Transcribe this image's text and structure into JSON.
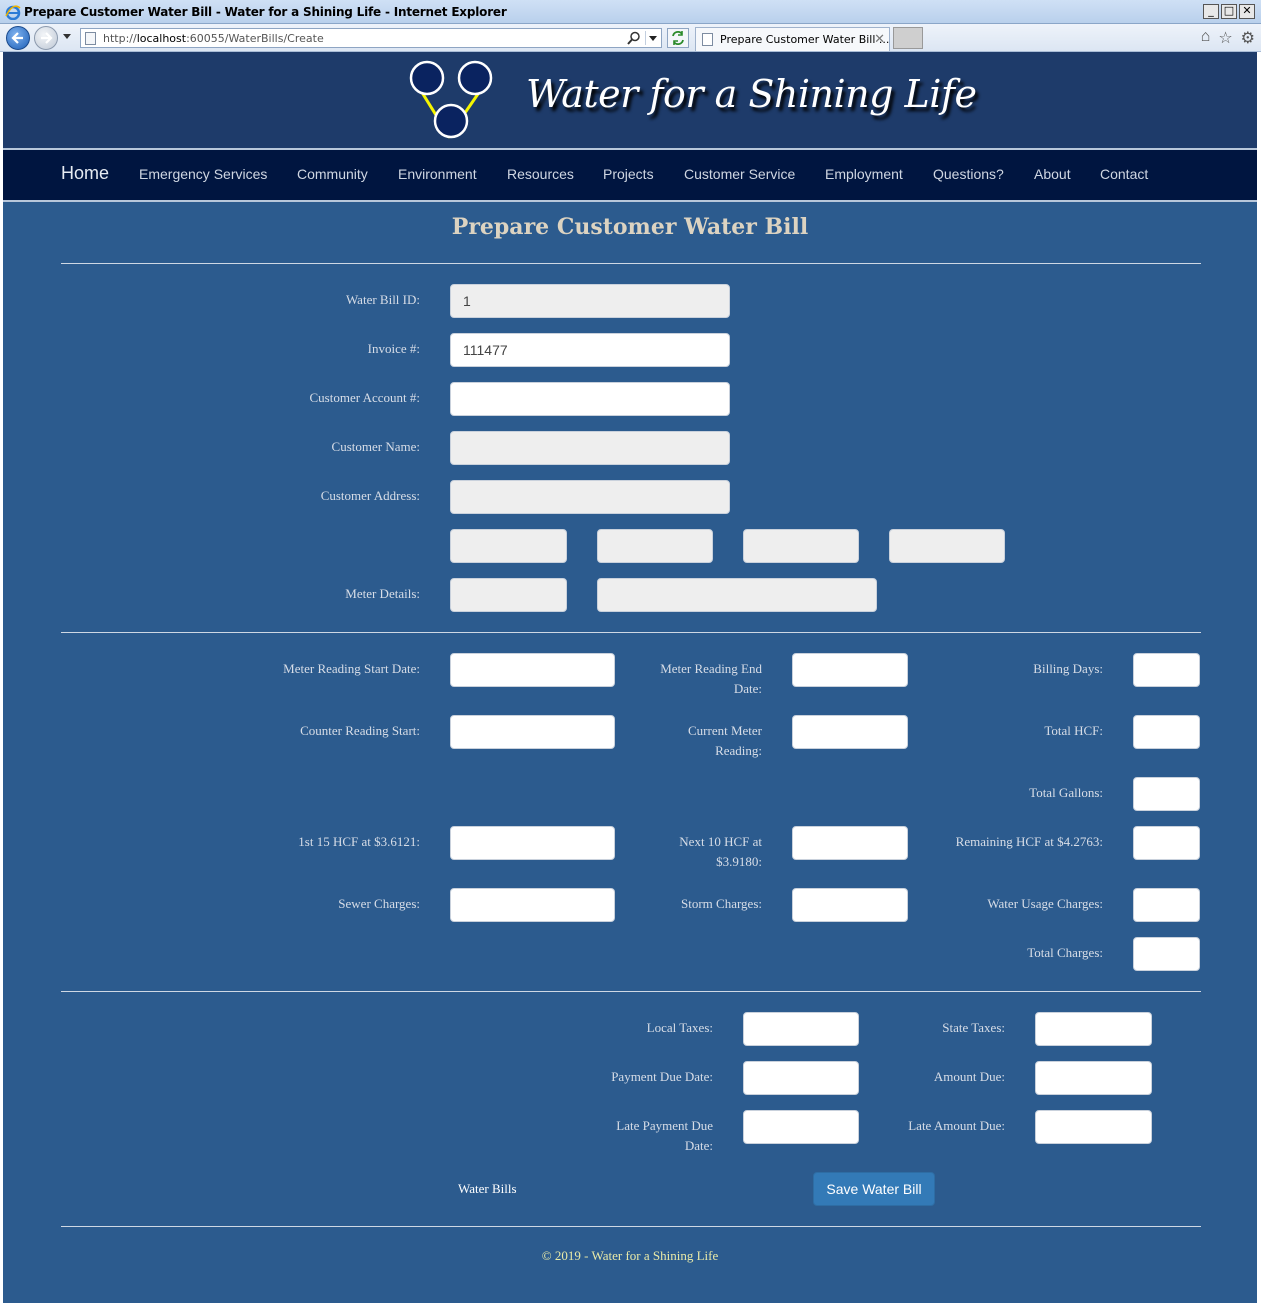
{
  "window": {
    "title": "Prepare Customer Water Bill - Water for a Shining Life - Internet Explorer",
    "url_prefix": "http://",
    "url_host": "localhost",
    "url_rest": ":60055/WaterBills/Create",
    "tab_label": "Prepare Customer Water Bill ...",
    "minimize": "_",
    "maximize": "□",
    "close": "✕"
  },
  "site": {
    "title": "Water for a Shining Life",
    "nav": [
      "Home",
      "Emergency Services",
      "Community",
      "Environment",
      "Resources",
      "Projects",
      "Customer Service",
      "Employment",
      "Questions?",
      "About",
      "Contact"
    ]
  },
  "page": {
    "title": "Prepare Customer Water Bill"
  },
  "form": {
    "water_bill_id": {
      "label": "Water Bill ID:",
      "value": "1"
    },
    "invoice": {
      "label": "Invoice #:",
      "value": "111477"
    },
    "customer_account": {
      "label": "Customer Account #:",
      "value": ""
    },
    "customer_name": {
      "label": "Customer Name:",
      "value": ""
    },
    "customer_address": {
      "label": "Customer Address:",
      "value": ""
    },
    "meter_details": {
      "label": "Meter Details:"
    },
    "meter_reading_start_date": {
      "label": "Meter Reading Start Date:"
    },
    "meter_reading_end_date": {
      "label_1": "Meter Reading End",
      "label_2": "Date:"
    },
    "billing_days": {
      "label": "Billing Days:"
    },
    "counter_reading_start": {
      "label": "Counter Reading Start:"
    },
    "current_meter_reading": {
      "label_1": "Current Meter",
      "label_2": "Reading:"
    },
    "total_hcf": {
      "label": "Total HCF:"
    },
    "total_gallons": {
      "label": "Total Gallons:"
    },
    "first_15_hcf": {
      "label": "1st 15 HCF at $3.6121:"
    },
    "next_10_hcf": {
      "label_1": "Next 10 HCF at",
      "label_2": "$3.9180:"
    },
    "remaining_hcf": {
      "label": "Remaining HCF at $4.2763:"
    },
    "sewer_charges": {
      "label": "Sewer Charges:"
    },
    "storm_charges": {
      "label": "Storm Charges:"
    },
    "water_usage_charges": {
      "label": "Water Usage Charges:"
    },
    "total_charges": {
      "label": "Total Charges:"
    },
    "local_taxes": {
      "label": "Local Taxes:"
    },
    "state_taxes": {
      "label": "State Taxes:"
    },
    "payment_due_date": {
      "label": "Payment Due Date:"
    },
    "amount_due": {
      "label": "Amount Due:"
    },
    "late_payment_due_date": {
      "label_1": "Late Payment Due",
      "label_2": "Date:"
    },
    "late_amount_due": {
      "label": "Late Amount Due:"
    }
  },
  "actions": {
    "back_link": "Water Bills",
    "save": "Save Water Bill"
  },
  "footer": {
    "text": "© 2019 - Water for a Shining Life"
  },
  "colors": {
    "page_bg": "#2c5b8e",
    "header_bg": "#1e3b6a",
    "navbar_bg": "#001540",
    "button": "#337ab7",
    "title_text": "#dcd3c1",
    "footer_text": "#e9eaa8"
  }
}
